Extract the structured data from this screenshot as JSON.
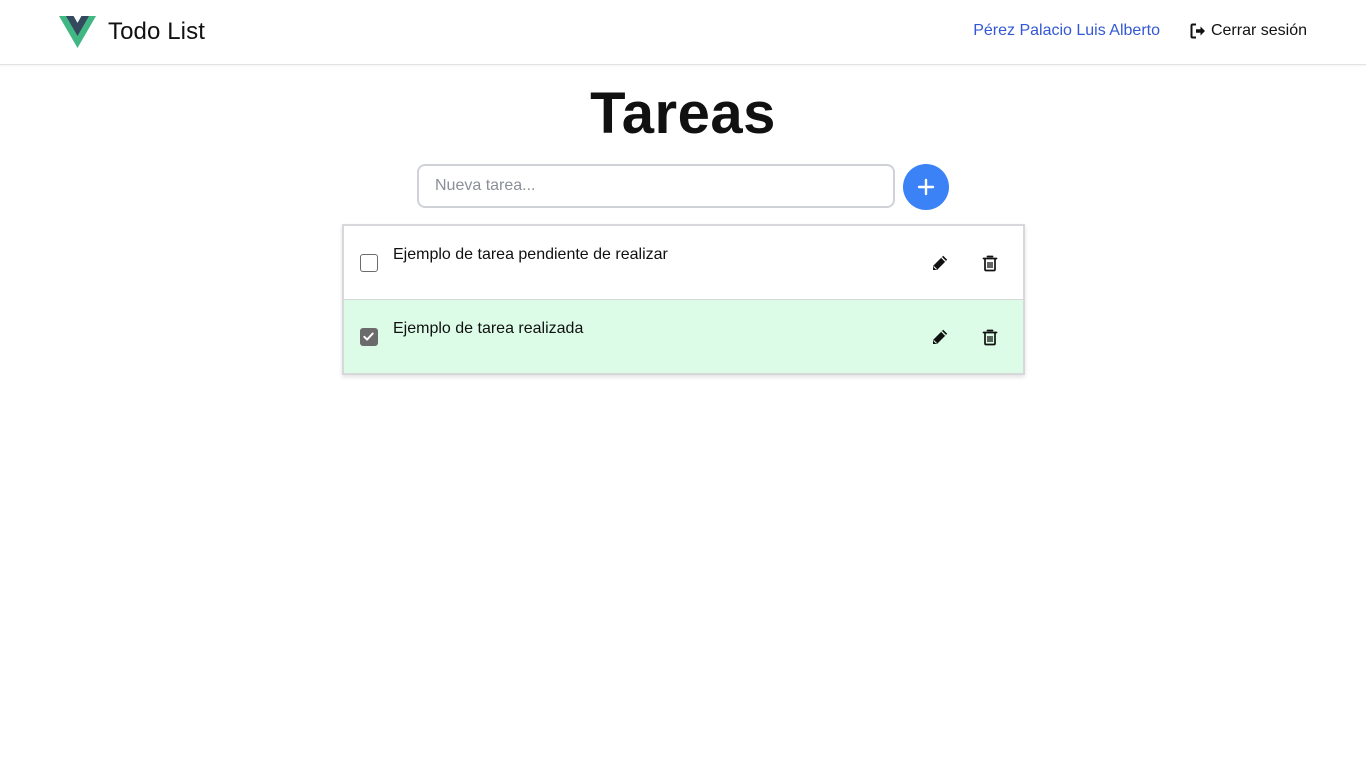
{
  "navbar": {
    "brand_label": "Todo List",
    "user_name": "Pérez Palacio Luis Alberto",
    "logout_label": "Cerrar sesión"
  },
  "page": {
    "title": "Tareas"
  },
  "new_task": {
    "placeholder": "Nueva tarea...",
    "value": "",
    "add_icon": "plus-icon"
  },
  "tasks": [
    {
      "text": "Ejemplo de tarea pendiente de realizar",
      "done": false
    },
    {
      "text": "Ejemplo de tarea realizada",
      "done": true
    }
  ],
  "colors": {
    "accent": "#3b82f6",
    "user_link": "#3358d4",
    "done_row_bg": "#dcfce7",
    "logo_green": "#41b883",
    "logo_dark": "#34495e"
  },
  "icons": {
    "logo": "vue-logo-icon",
    "logout": "sign-out-icon",
    "edit": "pencil-icon",
    "delete": "trash-icon",
    "check": "checkmark-icon"
  }
}
